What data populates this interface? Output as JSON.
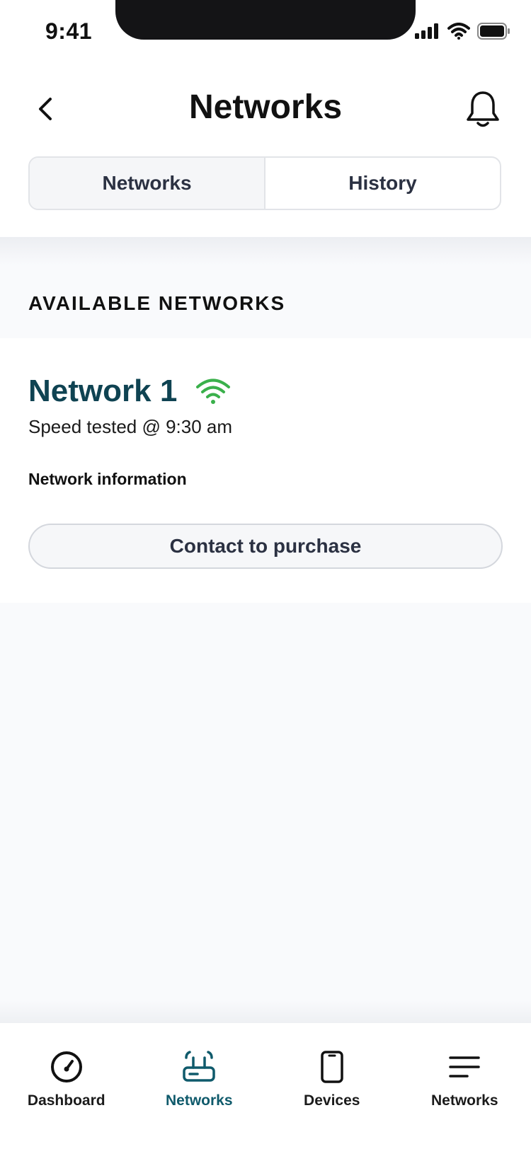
{
  "status_bar": {
    "time": "9:41"
  },
  "header": {
    "title": "Networks"
  },
  "segments": [
    {
      "label": "Networks",
      "active": true
    },
    {
      "label": "History",
      "active": false
    }
  ],
  "section": {
    "title": "AVAILABLE NETWORKS"
  },
  "network": {
    "name": "Network 1",
    "speed_text": "Speed tested @ 9:30 am",
    "info_link": "Network information",
    "purchase_label": "Contact to purchase",
    "signal_icon": "wifi-icon",
    "signal_color": "#3ab04b"
  },
  "tabbar": {
    "items": [
      {
        "label": "Dashboard",
        "icon": "speedometer-icon",
        "active": false
      },
      {
        "label": "Networks",
        "icon": "router-icon",
        "active": true
      },
      {
        "label": "Devices",
        "icon": "phone-icon",
        "active": false
      },
      {
        "label": "Networks",
        "icon": "menu-icon",
        "active": false
      }
    ]
  },
  "colors": {
    "accent": "#0f5a6b",
    "title_teal": "#0f4352",
    "signal_green": "#3ab04b"
  }
}
